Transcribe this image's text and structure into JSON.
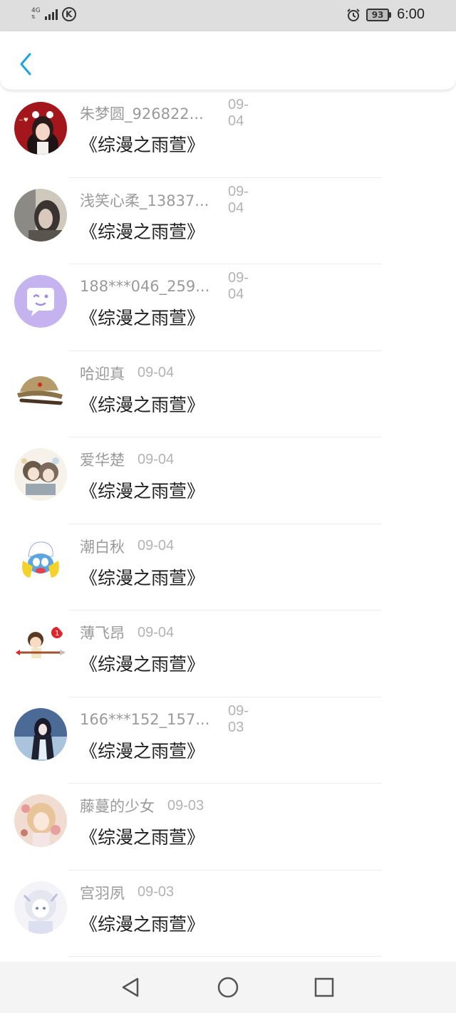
{
  "status_bar": {
    "network": "4G",
    "battery_level": "93",
    "time": "6:00"
  },
  "header": {
    "back_icon": "chevron-left-icon",
    "accent_color": "#1aa3e8"
  },
  "items": [
    {
      "name": "朱梦圆_926822...",
      "date": "09-04",
      "content": "《综漫之雨萱》",
      "avatar_icon": "girl-red-avatar"
    },
    {
      "name": "浅笑心柔_13837...",
      "date": "09-04",
      "content": "《综漫之雨萱》",
      "avatar_icon": "grey-photo-avatar"
    },
    {
      "name": "188***046_259...",
      "date": "09-04",
      "content": "《综漫之雨萱》",
      "avatar_icon": "purple-chat-default-avatar"
    },
    {
      "name": "哈迎真",
      "date": "09-04",
      "content": "《综漫之雨萱》",
      "avatar_icon": "army-hat-avatar"
    },
    {
      "name": "爱华楚",
      "date": "09-04",
      "content": "《综漫之雨萱》",
      "avatar_icon": "anime-sketch-avatar"
    },
    {
      "name": "潮白秋",
      "date": "09-04",
      "content": "《综漫之雨萱》",
      "avatar_icon": "smurf-avatar"
    },
    {
      "name": "薄飞昂",
      "date": "09-04",
      "content": "《综漫之雨萱》",
      "avatar_icon": "cupid-boy-avatar"
    },
    {
      "name": "166***152_157...",
      "date": "09-03",
      "content": "《综漫之雨萱》",
      "avatar_icon": "anime-blue-avatar"
    },
    {
      "name": "藤蔓的少女",
      "date": "09-03",
      "content": "《综漫之雨萱》",
      "avatar_icon": "anime-pink-avatar"
    },
    {
      "name": "宫羽夙",
      "date": "09-03",
      "content": "《综漫之雨萱》",
      "avatar_icon": "anime-white-avatar"
    }
  ],
  "nav": {
    "back_icon": "triangle-back-icon",
    "home_icon": "circle-home-icon",
    "recents_icon": "square-recents-icon"
  }
}
